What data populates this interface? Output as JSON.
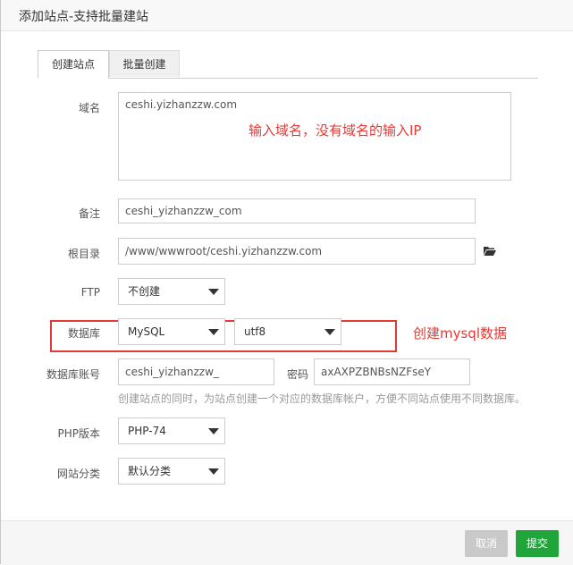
{
  "dialog": {
    "title": "添加站点-支持批量建站"
  },
  "tabs": [
    {
      "label": "创建站点"
    },
    {
      "label": "批量创建"
    }
  ],
  "form": {
    "domain": {
      "label": "域名",
      "value": "ceshi.yizhanzzw.com"
    },
    "remark": {
      "label": "备注",
      "value": "ceshi_yizhanzzw_com"
    },
    "root": {
      "label": "根目录",
      "value": "/www/wwwroot/ceshi.yizhanzzw.com",
      "icon": "folder-open-icon"
    },
    "ftp": {
      "label": "FTP",
      "value": "不创建"
    },
    "database": {
      "label": "数据库",
      "type": "MySQL",
      "charset": "utf8"
    },
    "db_account": {
      "label": "数据库账号",
      "value": "ceshi_yizhanzzw_",
      "password_label": "密码",
      "password": "axAXPZBNBsNZFseY"
    },
    "db_hint": "创建站点的同时，为站点创建一个对应的数据库帐户，方便不同站点使用不同数据库。",
    "php": {
      "label": "PHP版本",
      "value": "PHP-74"
    },
    "category": {
      "label": "网站分类",
      "value": "默认分类"
    }
  },
  "annotations": {
    "domain_note": "输入域名，没有域名的输入IP",
    "db_note": "创建mysql数据",
    "color": "#e53935"
  },
  "footer": {
    "cancel_label": "取消",
    "submit_label": "提交"
  },
  "colors": {
    "submit": "#20a53a",
    "cancel": "#c9c9c9"
  }
}
